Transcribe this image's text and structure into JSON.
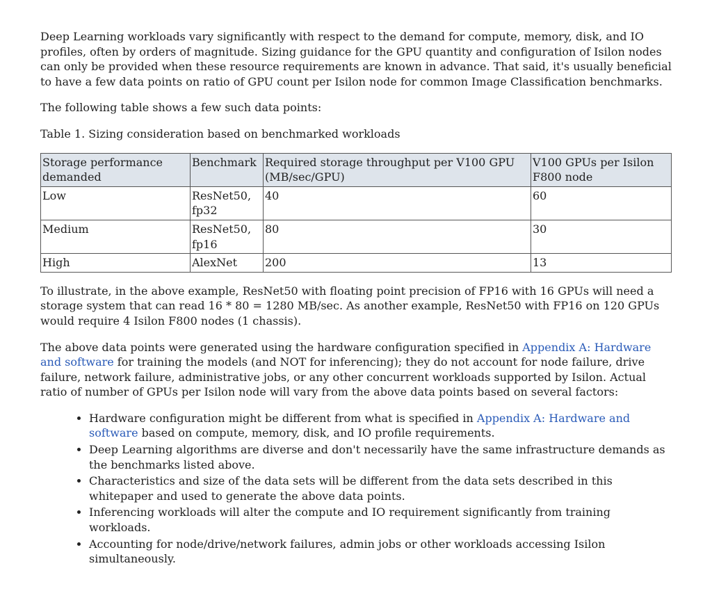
{
  "para_intro": "Deep Learning workloads vary significantly with respect to the demand for compute, memory, disk, and IO profiles, often by orders of magnitude. Sizing guidance for the GPU quantity and configuration of Isilon nodes can only be provided when these resource requirements are known in advance. That said, it's usually beneficial to have a few data points on ratio of GPU count per Isilon node for common Image Classification benchmarks.",
  "para_lead": "The following table shows a few such data points:",
  "table_caption": "Table 1. Sizing consideration based on benchmarked workloads",
  "table": {
    "headers": [
      "Storage performance demanded",
      "Benchmark",
      "Required storage throughput per V100 GPU (MB/sec/GPU)",
      "V100 GPUs per Isilon F800 node"
    ],
    "rows": [
      [
        "Low",
        "ResNet50, fp32",
        "40",
        "60"
      ],
      [
        "Medium",
        "ResNet50, fp16",
        "80",
        "30"
      ],
      [
        "High",
        "AlexNet",
        "200",
        "13"
      ]
    ]
  },
  "para_example": "To illustrate, in the above example, ResNet50 with floating point precision of FP16 with 16 GPUs will need a storage system that can read 16 * 80 = 1280 MB/sec. As another example, ResNet50 with FP16 on 120 GPUs would require 4 Isilon F800 nodes (1 chassis).",
  "para_above_pre": "The above data points were generated using the hardware configuration specified in ",
  "link_appendix_a": "Appendix A: Hardware and software",
  "para_above_post": " for training the models (and NOT for inferencing); they do not account for node failure, drive failure, network failure, administrative jobs, or any other concurrent workloads supported by Isilon. Actual ratio of number of GPUs per Isilon node will vary from the above data points based on several factors:",
  "bullets": {
    "b1_pre": "Hardware configuration might be different from what is specified in ",
    "b1_link": "Appendix A: Hardware and software",
    "b1_post": " based on compute, memory, disk, and IO profile requirements.",
    "b2": "Deep Learning algorithms are diverse and don't necessarily have the same infrastructure demands as the benchmarks listed above.",
    "b3": "Characteristics and size of the data sets will be different from the data sets described in this whitepaper and used to generate the above data points.",
    "b4": "Inferencing workloads will alter the compute and IO requirement significantly from training workloads.",
    "b5": "Accounting for node/drive/network failures, admin jobs or other workloads accessing Isilon simultaneously."
  },
  "chart_data": {
    "type": "table",
    "title": "Sizing consideration based on benchmarked workloads",
    "columns": [
      "Storage performance demanded",
      "Benchmark",
      "Required storage throughput per V100 GPU (MB/sec/GPU)",
      "V100 GPUs per Isilon F800 node"
    ],
    "rows": [
      {
        "perf": "Low",
        "benchmark": "ResNet50, fp32",
        "throughput_mb_s_per_gpu": 40,
        "gpus_per_f800_node": 60
      },
      {
        "perf": "Medium",
        "benchmark": "ResNet50, fp16",
        "throughput_mb_s_per_gpu": 80,
        "gpus_per_f800_node": 30
      },
      {
        "perf": "High",
        "benchmark": "AlexNet",
        "throughput_mb_s_per_gpu": 200,
        "gpus_per_f800_node": 13
      }
    ]
  }
}
